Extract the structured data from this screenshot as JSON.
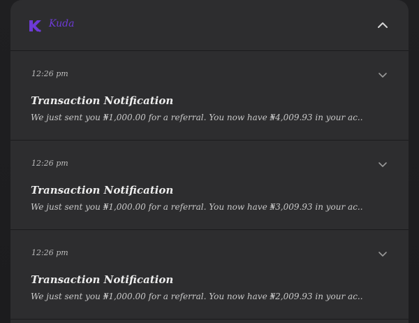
{
  "app": {
    "name": "Kuda",
    "logo_icon": "kuda-k-logo-icon",
    "brand_color": "#6d3ad6",
    "collapse_icon": "chevron-up-icon"
  },
  "notifications": [
    {
      "time": "12:26 pm",
      "title": "Transaction Notification",
      "body": "We just sent you ₦1,000.00 for a referral. You now have ₦4,009.93 in your ac..",
      "expand_icon": "chevron-down-icon"
    },
    {
      "time": "12:26 pm",
      "title": "Transaction Notification",
      "body": "We just sent you ₦1,000.00 for a referral. You now have ₦3,009.93 in your ac..",
      "expand_icon": "chevron-down-icon"
    },
    {
      "time": "12:26 pm",
      "title": "Transaction Notification",
      "body": "We just sent you ₦1,000.00 for a referral. You now have ₦2,009.93 in your ac..",
      "expand_icon": "chevron-down-icon"
    }
  ]
}
